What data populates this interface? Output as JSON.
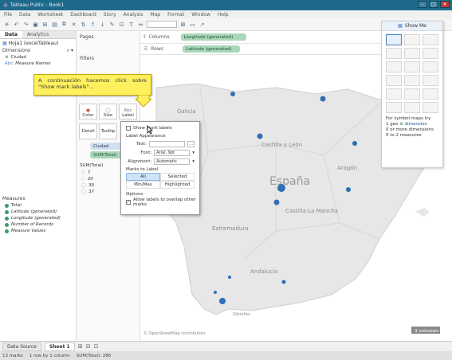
{
  "window": {
    "title": "Tableau Public - Book1",
    "buttons": [
      "–",
      "□",
      "✕"
    ]
  },
  "menu": [
    "File",
    "Data",
    "Worksheet",
    "Dashboard",
    "Story",
    "Analysis",
    "Map",
    "Format",
    "Window",
    "Help"
  ],
  "left": {
    "tabs": [
      "Data",
      "Analytics"
    ],
    "source": "Hoja1 (excelTableau)",
    "dimensions_header": "Dimensions",
    "dimensions": [
      "Ciudad",
      "Measure Names"
    ],
    "measures_header": "Measures",
    "measures": [
      "Total",
      "Latitude (generated)",
      "Longitude (generated)",
      "Number of Records",
      "Measure Values"
    ]
  },
  "shelves": {
    "pages": "Pages",
    "filters": "Filters",
    "cards": [
      "Color",
      "Size",
      "Label",
      "Detail",
      "Tooltip"
    ],
    "marks_pills": [
      "Ciudad",
      "SUM(Total)"
    ],
    "size_legend_title": "SUM(Total)",
    "size_legend": [
      "7",
      "20",
      "30",
      "37"
    ]
  },
  "columns": {
    "label": "Columns",
    "pill": "Longitude (generated)"
  },
  "rows": {
    "label": "Rows",
    "pill": "Latitude (generated)"
  },
  "map": {
    "labels": [
      "Galicia",
      "Castilla y León",
      "Aragón",
      "España",
      "Castilla-La Mancha",
      "Extremadura",
      "Andalucía",
      "Gibraltar"
    ],
    "attribution": "© OpenStreetMap contributors",
    "unknown": "3 unknown"
  },
  "callout": "A continuación hacemos click sobre \"Show mark labels\"...",
  "popup": {
    "show_labels": "Show mark labels",
    "appearance": "Label Appearance",
    "text_label": "Text:",
    "font_label": "Font:",
    "font_value": "Arial, 9pt",
    "align_label": "Alignment:",
    "align_value": "Automatic",
    "marks_to_label": "Marks to Label",
    "opts": [
      "All",
      "Selected",
      "Min/Max",
      "Highlighted"
    ],
    "options": "Options",
    "overlap": "Allow labels to overlap other marks"
  },
  "showme": {
    "title": "Show Me",
    "hint_title": "For symbol maps try",
    "hint1": "1 geo",
    "hint1b": "dimension",
    "hint2": "0 or more dimensions",
    "hint3": "0 to 2 measures"
  },
  "bottom": {
    "datasource": "Data Source",
    "sheet": "Sheet 1"
  },
  "status": [
    "13 marks",
    "1 row by 1 column",
    "SUM(Total): 286"
  ],
  "colors": {
    "accent": "#1d6a8a",
    "mark": "#2f6fb6",
    "pill_green": "#a8d8b9",
    "callout": "#fff15e"
  }
}
